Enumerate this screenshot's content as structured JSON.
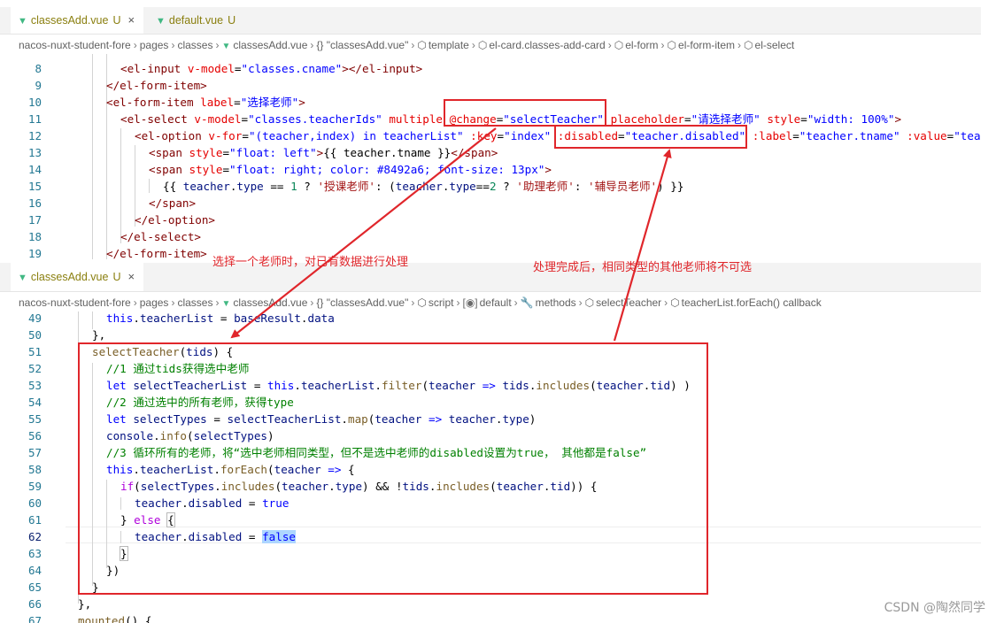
{
  "top_tabs": [
    {
      "name": "classesAdd.vue",
      "status": "U",
      "close": "×",
      "icon": "vue-icon"
    },
    {
      "name": "default.vue",
      "status": "U",
      "icon": "vue-icon"
    }
  ],
  "breadcrumb1": [
    "nacos-nuxt-student-fore",
    "pages",
    "classes",
    "classesAdd.vue",
    "{} \"classesAdd.vue\"",
    "template",
    "el-card.classes-add-card",
    "el-form",
    "el-form-item",
    "el-select"
  ],
  "lines1": [
    {
      "n": "8",
      "code": "<el-input v-model=\"classes.cname\"></el-input>"
    },
    {
      "n": "9",
      "code": "</el-form-item>"
    },
    {
      "n": "10",
      "code": "<el-form-item label=\"选择老师\">"
    },
    {
      "n": "11",
      "code": "<el-select v-model=\"classes.teacherIds\" multiple @change=\"selectTeacher\" placeholder=\"请选择老师\" style=\"width: 100%\">"
    },
    {
      "n": "12",
      "code": "<el-option v-for=\"(teacher,index) in teacherList\" :key=\"index\" :disabled=\"teacher.disabled\" :label=\"teacher.tname\" :value=\"teacher.tid\">"
    },
    {
      "n": "13",
      "code": "<span style=\"float: left\">{{ teacher.tname }}</span>"
    },
    {
      "n": "14",
      "code": "<span style=\"float: right; color: #8492a6; font-size: 13px\">"
    },
    {
      "n": "15",
      "code": "{{ teacher.type == 1 ? '授课老师': (teacher.type==2 ? '助理老师': '辅导员老师') }}"
    },
    {
      "n": "16",
      "code": "</span>"
    },
    {
      "n": "17",
      "code": "</el-option>"
    },
    {
      "n": "18",
      "code": "</el-select>"
    },
    {
      "n": "19",
      "code": "</el-form-item>"
    }
  ],
  "bottom_tab": {
    "name": "classesAdd.vue",
    "status": "U",
    "close": "×"
  },
  "breadcrumb2": [
    "nacos-nuxt-student-fore",
    "pages",
    "classes",
    "classesAdd.vue",
    "{} \"classesAdd.vue\"",
    "script",
    "default",
    "methods",
    "selectTeacher",
    "teacherList.forEach() callback"
  ],
  "lines2": [
    {
      "n": "49",
      "code": "this.teacherList = baseResult.data"
    },
    {
      "n": "50",
      "code": "},"
    },
    {
      "n": "51",
      "code": "selectTeacher(tids) {"
    },
    {
      "n": "52",
      "code": "//1 通过tids获得选中老师"
    },
    {
      "n": "53",
      "code": "let selectTeacherList = this.teacherList.filter(teacher => tids.includes(teacher.tid) )"
    },
    {
      "n": "54",
      "code": "//2 通过选中的所有老师，获得type"
    },
    {
      "n": "55",
      "code": "let selectTypes = selectTeacherList.map(teacher => teacher.type)"
    },
    {
      "n": "56",
      "code": "console.info(selectTypes)"
    },
    {
      "n": "57",
      "code": "//3 循环所有的老师，将“选中老师相同类型，但不是选中老师的disabled设置为true， 其他都是false”"
    },
    {
      "n": "58",
      "code": "this.teacherList.forEach(teacher => {"
    },
    {
      "n": "59",
      "code": "if(selectTypes.includes(teacher.type) && !tids.includes(teacher.tid)) {"
    },
    {
      "n": "60",
      "code": "teacher.disabled = true"
    },
    {
      "n": "61",
      "code": "} else {"
    },
    {
      "n": "62",
      "code": "teacher.disabled = false"
    },
    {
      "n": "63",
      "code": "}"
    },
    {
      "n": "64",
      "code": "})"
    },
    {
      "n": "65",
      "code": "}"
    },
    {
      "n": "66",
      "code": "},"
    },
    {
      "n": "67",
      "code": "mounted() {"
    }
  ],
  "annotations": {
    "note1": "选择一个老师时，对已有数据进行处理",
    "note2": "处理完成后，相同类型的其他老师将不可选"
  },
  "watermark": "CSDN @陶然同学",
  "colors": {
    "annotation_red": "#e0262b",
    "tag": "#800000",
    "attr": "#e50000",
    "string": "#0000ff",
    "comment": "#008000"
  }
}
